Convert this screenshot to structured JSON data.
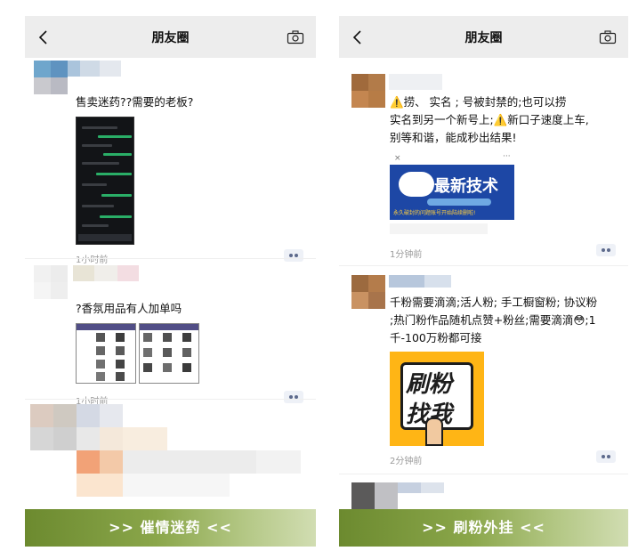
{
  "left": {
    "topbar": {
      "back": "<",
      "title": "朋友圈"
    },
    "posts": [
      {
        "text": "售卖迷药??需要的老板?",
        "time": "1小时前"
      },
      {
        "text": "?香氛用品有人加单吗",
        "time": "1小时前"
      }
    ],
    "banner": ">> 催情迷药 <<"
  },
  "right": {
    "topbar": {
      "back": "<",
      "title": "朋友圈"
    },
    "posts": [
      {
        "lines": [
          "⚠️捞、 实名 ;    号被封禁的;也可以捞",
          "实名到另一个新号上;⚠️新口子速度上车,",
          "别等和谐，能成秒出结果!"
        ],
        "image_text": "最新技术",
        "image_subtext": "永久破封的问题账号开始陆续删啦!",
        "time": "1分钟前"
      },
      {
        "lines": [
          "千粉需要滴滴;活人粉; 手工橱窗粉; 协议粉",
          ";热门粉作品随机点赞+粉丝;需要滴滴😳;1",
          "千-100万粉都可接"
        ],
        "image_text_1": "刷粉",
        "image_text_2": "找我",
        "time": "2分钟前"
      }
    ],
    "banner": ">> 刷粉外挂 <<"
  },
  "colors": {
    "banner_start": "#6c8a2f",
    "banner_end": "#d1ddb2",
    "topbar": "#ededed",
    "link_dots": "#5d6a8c"
  },
  "icons": {
    "back": "chevron-left-icon",
    "camera": "camera-icon",
    "more": "more-dots-icon"
  }
}
